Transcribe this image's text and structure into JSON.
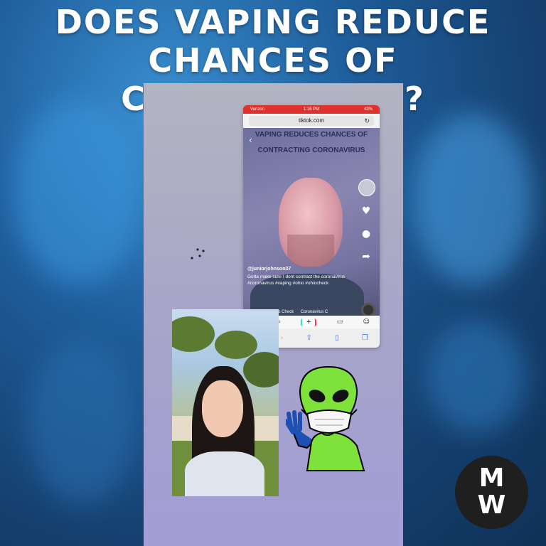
{
  "headline": {
    "line1": "DOES VAPING REDUCE",
    "line2": "CHANCES OF CORONAVIRUS?"
  },
  "phone": {
    "status": {
      "carrier": "Verizon",
      "time": "1:16 PM",
      "battery": "43%"
    },
    "url": "tiktok.com",
    "video_title_line1": "VAPING REDUCES CHANCES OF",
    "video_title_line2": "CONTRACTING CORONAVIRUS",
    "username": "@juniorjohnson37",
    "caption": "Gotta make sure I dont contract the coronavirus #coronavirus #vaping #ohio #ohiocheck",
    "music": [
      "Coronavirus Check",
      "Coronavirus C"
    ],
    "icons": [
      "back-chevron-icon",
      "profile-icon",
      "heart-icon",
      "comment-icon",
      "share-icon",
      "music-disc-icon",
      "home-icon",
      "search-icon",
      "plus-icon",
      "inbox-icon",
      "me-icon"
    ]
  },
  "logo": {
    "top": "M",
    "bottom": "W"
  },
  "colors": {
    "headline": "#ffffff",
    "status_bar": "#e0312f",
    "alien": "#7ee23b",
    "logo_bg": "#1f1f1f"
  }
}
